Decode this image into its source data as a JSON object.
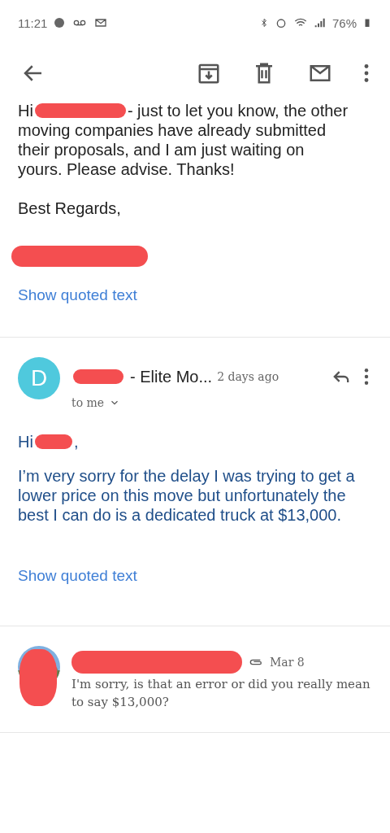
{
  "status_bar": {
    "time": "11:21",
    "battery": "76%"
  },
  "first_message": {
    "greeting": "Hi",
    "greeting_rest": "- just to let you know, the other",
    "body": "moving companies have already submitted their proposals, and I am just waiting on yours. Please advise. Thanks!",
    "signoff": "Best Regards,",
    "show_quoted": "Show quoted text"
  },
  "second_message": {
    "avatar_letter": "D",
    "sender_suffix": "- Elite Mo...",
    "time": "2 days ago",
    "recipient": "to me",
    "greeting": "Hi",
    "greeting_end": ",",
    "body": "I’m very sorry for the delay I was trying to get a lower price on this move but unfortunately the best I can do is a dedicated truck at $13,000.",
    "show_quoted": "Show quoted text"
  },
  "third_message": {
    "date": "Mar 8",
    "snippet": "I'm sorry, is that an error or did you really mean to say $13,000?"
  }
}
